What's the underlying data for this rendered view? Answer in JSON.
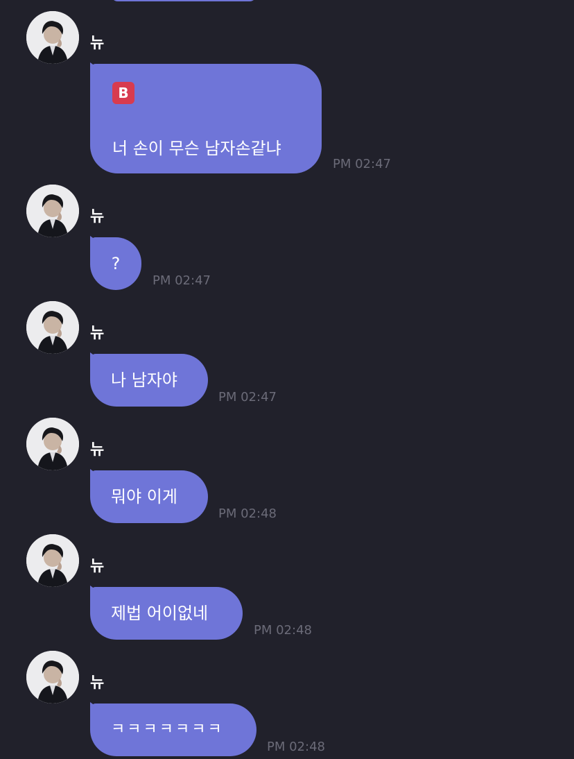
{
  "sender_name": "뉴",
  "accent_color": "#6f75d8",
  "background_color": "#21212b",
  "messages": [
    {
      "icon": "b-badge-icon",
      "icon_text": "B",
      "text": "너 손이 무슨 남자손같냐",
      "time": "PM 02:47"
    },
    {
      "text": "?",
      "time": "PM 02:47"
    },
    {
      "text": "나 남자야",
      "time": "PM 02:47"
    },
    {
      "text": "뭐야 이게",
      "time": "PM 02:48"
    },
    {
      "text": "제법 어이없네",
      "time": "PM 02:48"
    },
    {
      "text": "ㅋㅋㅋㅋㅋㅋㅋ",
      "time": "PM 02:48"
    }
  ]
}
